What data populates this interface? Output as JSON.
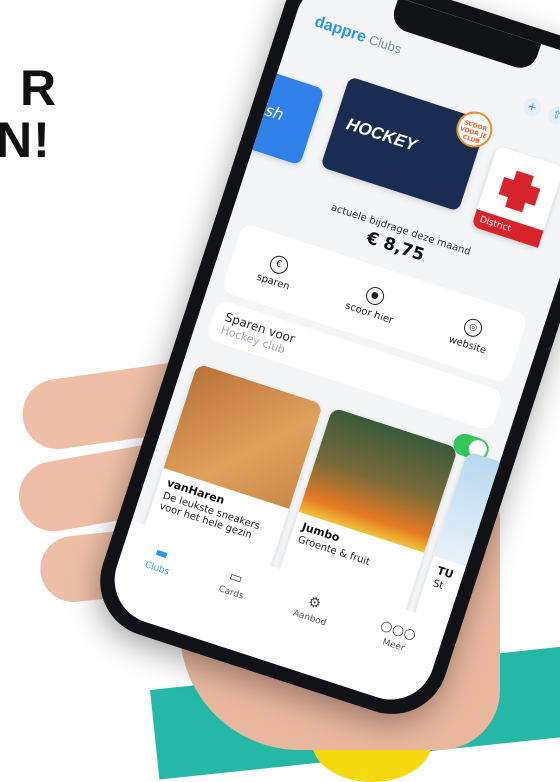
{
  "headline": {
    "line1": "R",
    "line2": "N!"
  },
  "app": {
    "brand": "dappre",
    "section": "Clubs"
  },
  "topbar": {
    "icons": [
      "plus-icon",
      "share-icon",
      "more-icon"
    ]
  },
  "cards": {
    "left_text": "fish",
    "main_title": "HOCKEY",
    "badge_text": "SCOOR VOOR JE CLUB",
    "right_label": "District"
  },
  "contribution": {
    "label": "actuele bijdrage deze maand",
    "amount": "€ 8,75"
  },
  "actions": [
    {
      "icon": "euro-icon",
      "glyph": "€",
      "label": "sparen"
    },
    {
      "icon": "location-pin-icon",
      "glyph": "●",
      "label": "scoor hier"
    },
    {
      "icon": "compass-icon",
      "glyph": "◎",
      "label": "website"
    }
  ],
  "saving": {
    "title": "Sparen voor",
    "placeholder": "Hockey club"
  },
  "toggle": {
    "on": true
  },
  "offers": [
    {
      "name": "vanHaren",
      "description": "De leukste sneakers voor het hele gezin"
    },
    {
      "name": "Jumbo",
      "description": "Groente & fruit"
    },
    {
      "name": "TU",
      "description": "St"
    }
  ],
  "tabs": [
    {
      "label": "Clubs",
      "glyph": "▬",
      "active": true
    },
    {
      "label": "Cards",
      "glyph": "▭",
      "active": false
    },
    {
      "label": "Aanbod",
      "glyph": "⚙",
      "active": false
    },
    {
      "label": "Meer",
      "glyph": "○○○",
      "active": false
    }
  ],
  "colors": {
    "brand_blue": "#2a96e8",
    "hockey_navy": "#1a2c52",
    "toggle_green": "#34c759",
    "band_teal": "#26b8a6",
    "blob_yellow": "#f5d90f",
    "cross_red": "#d7232b"
  }
}
